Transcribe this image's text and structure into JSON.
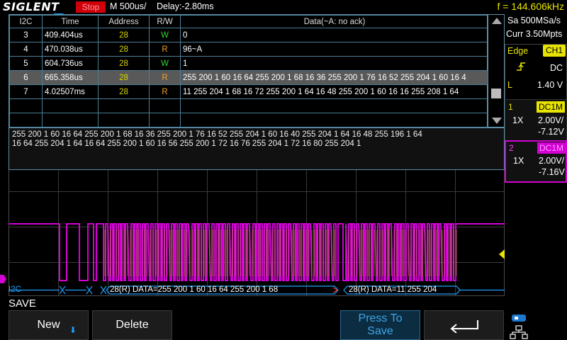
{
  "topbar": {
    "logo": "SIGLENT",
    "run_status": "Stop",
    "timebase": "M 500us/",
    "delay": "Delay:-2.80ms",
    "frequency": "f = 144.606kHz"
  },
  "decode_table": {
    "columns": [
      "I2C",
      "Time",
      "Address",
      "R/W",
      "Data(~A: no ack)"
    ],
    "rows": [
      {
        "idx": "3",
        "time": "409.404us",
        "address": "28",
        "rw": "W",
        "data": "0"
      },
      {
        "idx": "4",
        "time": "470.038us",
        "address": "28",
        "rw": "R",
        "data": "96~A"
      },
      {
        "idx": "5",
        "time": "604.736us",
        "address": "28",
        "rw": "W",
        "data": "1"
      },
      {
        "idx": "6",
        "time": "665.358us",
        "address": "28",
        "rw": "R",
        "data": "255 200 1 60 16 64 255 200 1 68 16 36 255 200 1 76 16 52 255 204 1 60 16 4",
        "selected": true
      },
      {
        "idx": "7",
        "time": "4.02507ms",
        "address": "28",
        "rw": "R",
        "data": "11 255 204 1 68 16 72 255 200 1 64 16 48 255 200 1 60 16 16 255 208 1 64"
      }
    ]
  },
  "detail": {
    "line1": "255 200 1 60 16 64 255 200 1 68 16 36 255 200 1 76 16 52 255 204 1 60 16 40 255 204 1 64 16 48 255 196 1 64",
    "line2": "16 64 255 204 1 64 16 64 255 200 1 60 16 56 255 200 1 72 16 76 255 204 1 72 16 80 255 204 1"
  },
  "bus": {
    "label": "I2C",
    "segment1": "28(R)  DATA=255 200 1 60 16 64 255 200 1 68",
    "segment2": "28(R)  DATA=11 255 204"
  },
  "right_panel": {
    "sample_rate": "Sa 500MSa/s",
    "memory_depth": "Curr 3.50Mpts",
    "trigger_type": "Edge",
    "trigger_source": "CH1",
    "trigger_coupling": "DC",
    "trigger_level_prefix": "L",
    "trigger_level": "1.40 V",
    "ch1": {
      "number": "1",
      "coupling": "DC1M",
      "probe": "1X",
      "scale": "2.00V/",
      "offset": "-7.12V"
    },
    "ch2": {
      "number": "2",
      "coupling": "DC1M",
      "probe": "1X",
      "scale": "2.00V/",
      "offset": "-7.16V"
    }
  },
  "menu": {
    "title": "SAVE",
    "buttons": {
      "new": "New",
      "delete": "Delete",
      "press_line1": "Press To",
      "press_line2": "Save"
    }
  },
  "colors": {
    "ch1": "#e8e400",
    "ch2": "#d400d4",
    "decode": "#1ea0ff",
    "stop": "#d0000a"
  }
}
